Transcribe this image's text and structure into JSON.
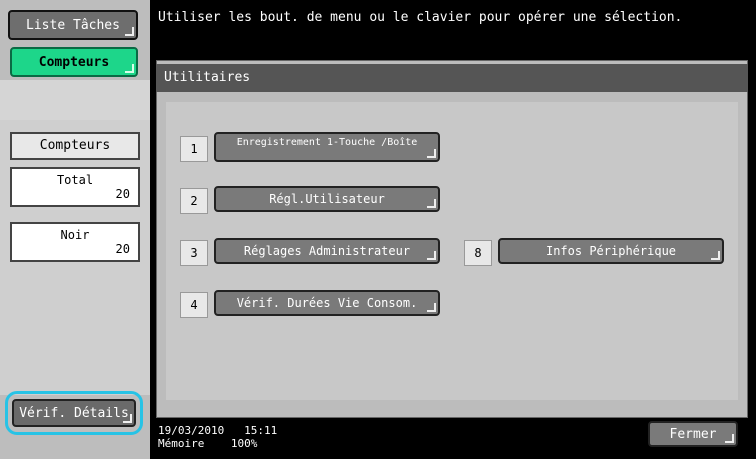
{
  "left": {
    "liste_taches_label": "Liste Tâches",
    "compteurs_tab_label": "Compteurs",
    "counters_title": "Compteurs",
    "total_label": "Total",
    "total_value": "20",
    "noir_label": "Noir",
    "noir_value": "20",
    "verif_details_label": "Vérif. Détails"
  },
  "header": {
    "message": "Utiliser les bout. de menu ou le clavier pour opérer une sélection."
  },
  "utilitaires": {
    "title": "Utilitaires",
    "items": [
      {
        "num": "1",
        "label": "Enregistrement 1-Touche /Boîte"
      },
      {
        "num": "2",
        "label": "Régl.Utilisateur"
      },
      {
        "num": "3",
        "label": "Réglages Administrateur"
      },
      {
        "num": "8",
        "label": "Infos Périphérique"
      },
      {
        "num": "4",
        "label": "Vérif. Durées Vie Consom."
      }
    ]
  },
  "status": {
    "date": "19/03/2010",
    "time": "15:11",
    "memory_label": "Mémoire",
    "memory_value": "100%"
  },
  "footer": {
    "fermer_label": "Fermer"
  },
  "colors": {
    "accent_green": "#1dd68a",
    "highlight_cyan": "#27c3e6"
  }
}
